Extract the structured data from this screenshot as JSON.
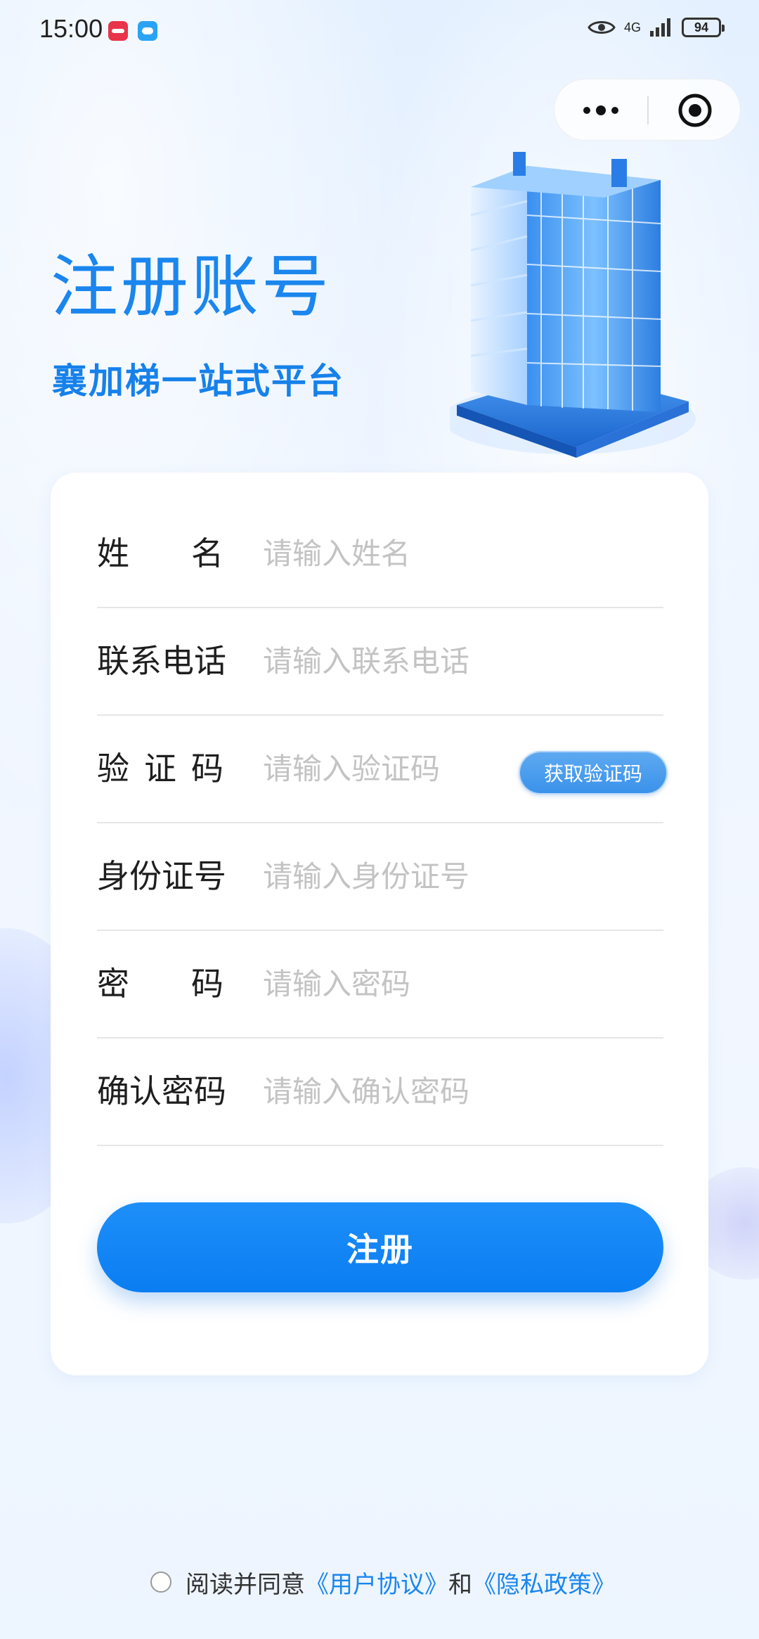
{
  "status_bar": {
    "time": "15:00",
    "network": "4G",
    "battery": "94"
  },
  "header": {
    "title": "注册账号",
    "subtitle": "襄加梯一站式平台"
  },
  "form": {
    "fields": [
      {
        "label": "姓名",
        "placeholder": "请输入姓名",
        "value": ""
      },
      {
        "label": "联系电话",
        "placeholder": "请输入联系电话",
        "value": ""
      },
      {
        "label": "验证码",
        "placeholder": "请输入验证码",
        "value": ""
      },
      {
        "label": "身份证号",
        "placeholder": "请输入身份证号",
        "value": ""
      },
      {
        "label": "密码",
        "placeholder": "请输入密码",
        "value": ""
      },
      {
        "label": "确认密码",
        "placeholder": "请输入确认密码",
        "value": ""
      }
    ],
    "code_button_label": "获取验证码",
    "submit_label": "注册"
  },
  "agreement": {
    "checked": false,
    "prefix": "阅读并同意",
    "user_agreement": "《用户协议》",
    "connector": "和",
    "privacy_policy": "《隐私政策》"
  },
  "colors": {
    "accent": "#1a86ee",
    "button": "#0a7df2",
    "placeholder": "#c3c3c3"
  },
  "icons": {
    "capsule_more": "more-dots-icon",
    "capsule_close": "target-close-icon",
    "illustration": "building-illustration"
  }
}
